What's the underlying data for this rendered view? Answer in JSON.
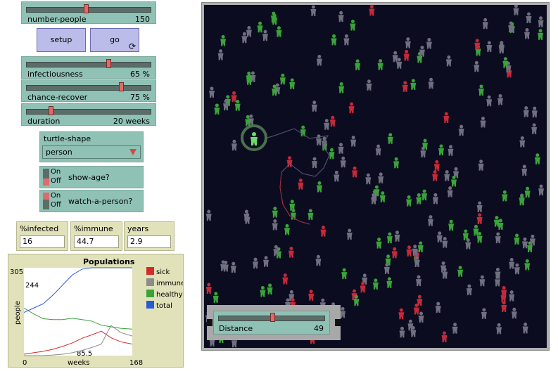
{
  "sliders": [
    {
      "label": "number-people",
      "value": "150",
      "level": 0.48
    },
    {
      "label": "infectiousness",
      "value": "65 %",
      "level": 0.65
    },
    {
      "label": "chance-recover",
      "value": "75 %",
      "level": 0.75
    },
    {
      "label": "duration",
      "value": "20 weeks",
      "level": 0.2
    }
  ],
  "buttons": {
    "setup": "setup",
    "go": "go",
    "go_icon": "forever-loop-icon"
  },
  "chooser": {
    "label": "turtle-shape",
    "value": "person"
  },
  "switches": [
    {
      "label": "show-age?",
      "on_text": "On",
      "off_text": "Off",
      "state": "off"
    },
    {
      "label": "watch-a-person?",
      "on_text": "On",
      "off_text": "Off",
      "state": "on"
    }
  ],
  "monitors": [
    {
      "label": "%infected",
      "value": "16"
    },
    {
      "label": "%immune",
      "value": "44.7"
    },
    {
      "label": "years",
      "value": "2.9"
    }
  ],
  "plot": {
    "title": "Populations",
    "xlabel": "weeks",
    "ylabel": "people",
    "xmin_label": "0",
    "xmax_label": "168",
    "ymax_label": "305",
    "y_marker_label": "244",
    "x_marker_label": "85.5"
  },
  "chart_data": {
    "type": "line",
    "title": "Populations",
    "xlabel": "weeks",
    "ylabel": "people",
    "xlim": [
      0,
      168
    ],
    "ylim": [
      0,
      305
    ],
    "x": [
      0,
      15,
      30,
      45,
      60,
      75,
      90,
      105,
      120,
      135,
      150,
      168
    ],
    "series": [
      {
        "name": "sick",
        "color": "#d42a2a",
        "values": [
          5,
          10,
          15,
          22,
          32,
          44,
          60,
          72,
          85,
          62,
          48,
          40
        ]
      },
      {
        "name": "immune",
        "color": "#8c8c8c",
        "values": [
          0,
          0,
          0,
          2,
          5,
          10,
          18,
          28,
          40,
          105,
          80,
          68
        ]
      },
      {
        "name": "healthy",
        "color": "#3aa33a",
        "values": [
          165,
          145,
          128,
          125,
          125,
          130,
          125,
          120,
          106,
          100,
          95,
          92
        ]
      },
      {
        "name": "total",
        "color": "#2a5ad4",
        "values": [
          150,
          165,
          180,
          210,
          245,
          280,
          300,
          305,
          305,
          305,
          305,
          305
        ]
      }
    ],
    "legend_placement": "right"
  },
  "distance_slider": {
    "label": "Distance",
    "value": "49",
    "level": 0.55
  },
  "colors": {
    "healthy": "#3aa33a",
    "sick": "#c42a3a",
    "immune": "#6f6f80",
    "world_bg": "#0c0c20",
    "watched": "#6bdc6b"
  }
}
